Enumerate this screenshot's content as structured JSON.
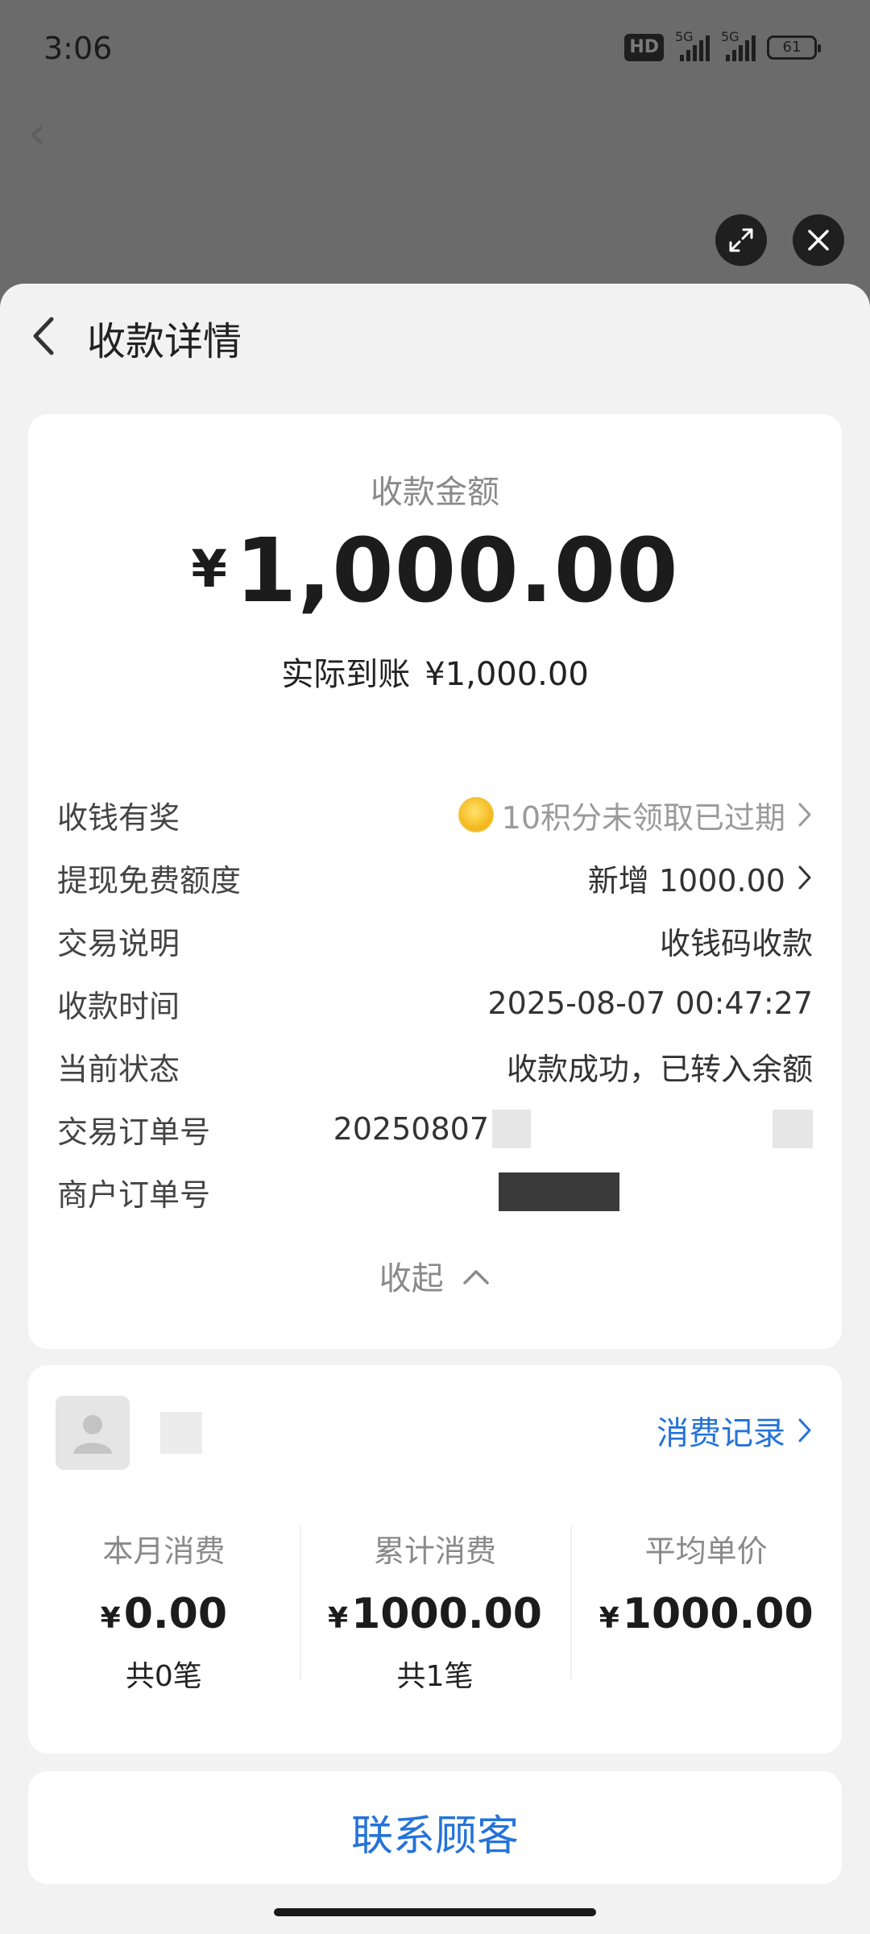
{
  "status_bar": {
    "time": "3:06",
    "hd": "HD",
    "sim1": "5G",
    "sim2": "5G",
    "battery": "61"
  },
  "header": {
    "title": "收款详情"
  },
  "amount_card": {
    "label": "收款金额",
    "currency": "¥",
    "amount": "1,000.00",
    "actual_label": "实际到账",
    "actual_value": "¥1,000.00",
    "rows": [
      {
        "key": "收钱有奖",
        "value": "10积分未领取已过期"
      },
      {
        "key": "提现免费额度",
        "value": "新增 1000.00"
      },
      {
        "key": "交易说明",
        "value": "收钱码收款"
      },
      {
        "key": "收款时间",
        "value": "2025-08-07 00:47:27"
      },
      {
        "key": "当前状态",
        "value": "收款成功，已转入余额"
      },
      {
        "key": "交易订单号",
        "value": "20250807"
      },
      {
        "key": "商户订单号",
        "value": ""
      }
    ],
    "collapse_label": "收起"
  },
  "customer_card": {
    "records_link": "消费记录",
    "stats": [
      {
        "title": "本月消费",
        "currency": "¥",
        "value": "0.00",
        "count": "共0笔"
      },
      {
        "title": "累计消费",
        "currency": "¥",
        "value": "1000.00",
        "count": "共1笔"
      },
      {
        "title": "平均单价",
        "currency": "¥",
        "value": "1000.00",
        "count": ""
      }
    ]
  },
  "contact_button": "联系顾客",
  "colors": {
    "accent": "#2473d9",
    "sheet_bg": "#f2f2f2",
    "overlay": "#6b6b6b"
  }
}
